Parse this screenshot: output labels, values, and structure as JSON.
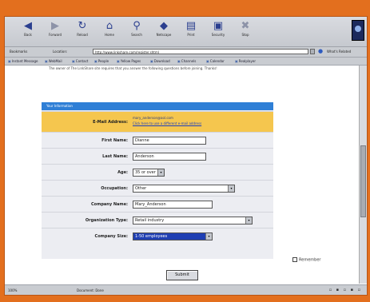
{
  "toolbar": {
    "buttons": [
      {
        "label": "Back",
        "icon": "back-arrow-icon"
      },
      {
        "label": "Forward",
        "icon": "forward-arrow-icon"
      },
      {
        "label": "Reload",
        "icon": "reload-icon"
      },
      {
        "label": "Home",
        "icon": "home-icon"
      },
      {
        "label": "Search",
        "icon": "search-icon"
      },
      {
        "label": "Netscape",
        "icon": "netscape-icon"
      },
      {
        "label": "Print",
        "icon": "print-icon"
      },
      {
        "label": "Security",
        "icon": "security-icon"
      },
      {
        "label": "Stop",
        "icon": "stop-icon"
      }
    ]
  },
  "location": {
    "bookmarks_label": "Bookmarks",
    "location_label": "Location:",
    "url": "http://www.linkshare.com/register.shtml",
    "whats_related": "What's Related"
  },
  "personal_toolbar": {
    "items": [
      "Instant Message",
      "WebMail",
      "Contact",
      "People",
      "Yellow Pages",
      "Download",
      "Channels",
      "Calendar",
      "Realplayer"
    ]
  },
  "page": {
    "intro_text": "The owner of The LinkShare site requires that you answer the following questions before joining. Thanks!",
    "panel_title": "Your Information",
    "email": {
      "label": "E-Mail Address:",
      "value": "mary_anderson@aol.com",
      "link": "Click here to use a different e-mail address"
    },
    "fields": [
      {
        "label": "First Name:",
        "value": "Dianne",
        "type": "text"
      },
      {
        "label": "Last Name:",
        "value": "Anderson",
        "type": "text"
      },
      {
        "label": "Age:",
        "value": "35 or over",
        "type": "select"
      },
      {
        "label": "Occupation:",
        "value": "Other",
        "type": "select"
      },
      {
        "label": "Company Name:",
        "value": "Mary_Anderson",
        "type": "text"
      },
      {
        "label": "Organization Type:",
        "value": "Retail industry",
        "type": "select"
      },
      {
        "label": "Company Size:",
        "value": "1-50 employees",
        "type": "select",
        "highlighted": true
      }
    ],
    "remember_label": "Remember",
    "submit_label": "Submit"
  },
  "statusbar": {
    "progress": "100%",
    "status": "Document: Done"
  },
  "colors": {
    "outer_background": "#e36f1e",
    "panel_header": "#2f7fd6",
    "email_row": "#f5c64e"
  }
}
